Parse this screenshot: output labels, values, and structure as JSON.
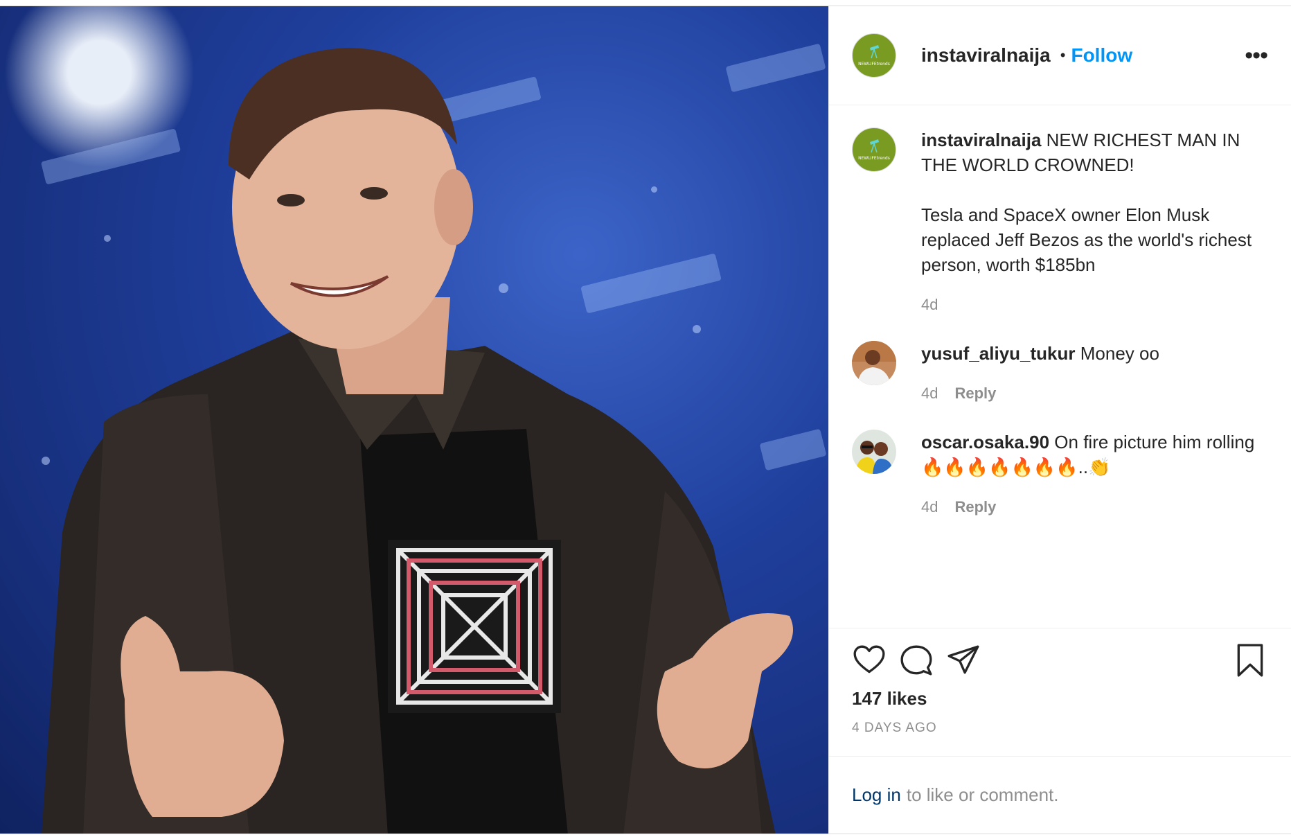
{
  "post": {
    "author": "instaviralnaija",
    "author_avatar_text": "NEWLIFEtrends",
    "separator": "•",
    "follow_label": "Follow",
    "more_label": "•••"
  },
  "caption": {
    "username": "instaviralnaija",
    "text_line1": "NEW RICHEST MAN IN THE WORLD CROWNED!",
    "text_line2": "Tesla and SpaceX owner Elon Musk replaced Jeff Bezos as the world's richest person, worth $185bn",
    "time": "4d"
  },
  "comments": [
    {
      "username": "yusuf_aliyu_tukur",
      "text": "Money oo",
      "time": "4d",
      "reply_label": "Reply"
    },
    {
      "username": "oscar.osaka.90",
      "text": "On fire picture him rolling🔥🔥🔥🔥🔥🔥🔥..👏",
      "time": "4d",
      "reply_label": "Reply"
    }
  ],
  "actions": {
    "icons": [
      "heart-icon",
      "comment-icon",
      "share-icon",
      "bookmark-icon"
    ],
    "likes": "147 likes",
    "posted": "4 DAYS AGO"
  },
  "login": {
    "link": "Log in",
    "text": "to like or comment."
  },
  "colors": {
    "follow": "#0095f6",
    "link": "#00376b",
    "muted": "#8e8e8e",
    "avatar_green": "#7a9b22"
  }
}
